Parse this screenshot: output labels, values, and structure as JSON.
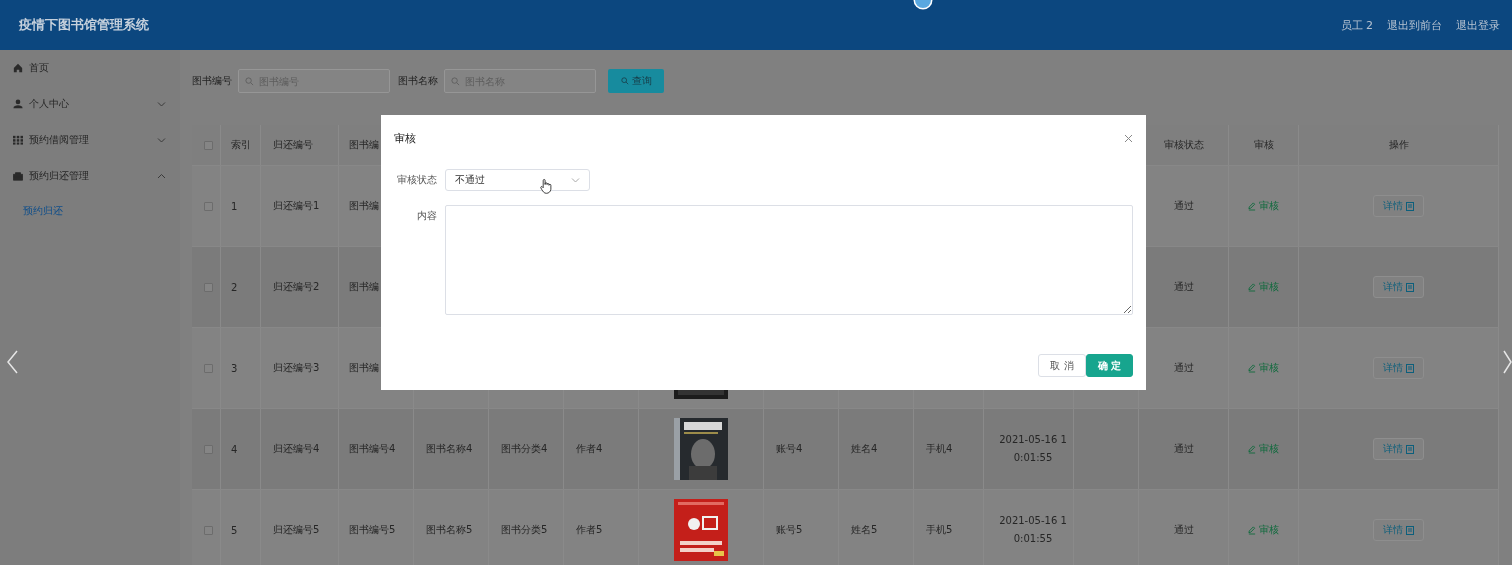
{
  "header": {
    "title": "疫情下图书馆管理系统",
    "links": [
      "员工 2",
      "退出到前台",
      "退出登录"
    ]
  },
  "sidebar": {
    "items": [
      {
        "label": "首页",
        "kind": "link"
      },
      {
        "label": "个人中心",
        "kind": "menu",
        "expanded": false
      },
      {
        "label": "预约借阅管理",
        "kind": "menu",
        "expanded": false
      },
      {
        "label": "预约归还管理",
        "kind": "menu",
        "expanded": true,
        "children": [
          {
            "label": "预约归还",
            "selected": true
          }
        ]
      }
    ]
  },
  "search": {
    "fields": [
      {
        "label": "图书编号",
        "placeholder": "图书编号"
      },
      {
        "label": "图书名称",
        "placeholder": "图书名称"
      }
    ],
    "button": "查询"
  },
  "table": {
    "select_all": {
      "checked": false
    },
    "columns": {
      "index": "索引",
      "return_no": "归还编号",
      "book_no": "图书编",
      "status": "审核状态",
      "review": "审核",
      "actions": "操作"
    },
    "rows": [
      {
        "checked": false,
        "index": "1",
        "return_no": "归还编号1",
        "book_no": "图书编",
        "status": "通过",
        "review": "审核",
        "detail": "详情"
      },
      {
        "checked": false,
        "index": "2",
        "return_no": "归还编号2",
        "book_no": "图书编",
        "status": "通过",
        "review": "审核",
        "detail": "详情"
      },
      {
        "checked": false,
        "index": "3",
        "return_no": "归还编号3",
        "book_no": "图书编",
        "status": "通过",
        "review": "审核",
        "detail": "详情"
      },
      {
        "checked": false,
        "index": "4",
        "return_no": "归还编号4",
        "book_no": "图书编号4",
        "book_name": "图书名称4",
        "category": "图书分类4",
        "author": "作者4",
        "account": "账号4",
        "name": "姓名4",
        "phone": "手机4",
        "time": "2021-05-16 10:01:55",
        "status": "通过",
        "review": "审核",
        "detail": "详情"
      },
      {
        "checked": false,
        "index": "5",
        "return_no": "归还编号5",
        "book_no": "图书编号5",
        "book_name": "图书名称5",
        "category": "图书分类5",
        "author": "作者5",
        "account": "账号5",
        "name": "姓名5",
        "phone": "手机5",
        "time": "2021-05-16 10:01:55",
        "status": "通过",
        "review": "审核",
        "detail": "详情"
      }
    ]
  },
  "dialog": {
    "title": "审核",
    "fields": [
      {
        "label": "审核状态",
        "kind": "select",
        "value": "不通过"
      },
      {
        "label": "内容",
        "kind": "textarea"
      }
    ],
    "buttons": [
      {
        "label": "取 消",
        "kind": "default"
      },
      {
        "label": "确 定",
        "kind": "primary"
      }
    ]
  }
}
